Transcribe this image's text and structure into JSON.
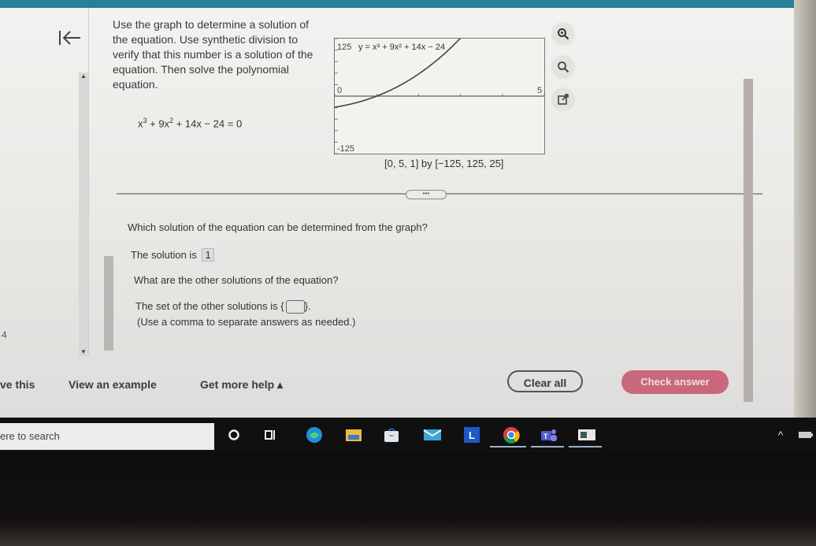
{
  "problem": {
    "instructions": "Use the graph to determine a solution of the equation. Use synthetic division to verify that this number is a solution of the equation. Then solve the polynomial equation.",
    "equation": {
      "term1_base": "x",
      "term1_exp": "3",
      "term2": " + 9x",
      "term2_exp": "2",
      "rest": " + 14x − 24 = 0"
    }
  },
  "side_panel": {
    "back_icon": "collapse-left-icon",
    "side_number": "4"
  },
  "graph_tools": [
    {
      "name": "zoom-in-icon"
    },
    {
      "name": "zoom-out-icon"
    },
    {
      "name": "popout-icon"
    }
  ],
  "chart_data": {
    "type": "line",
    "title": "y = x^3 + 9x^2 + 14x − 24",
    "function_label": "y = x³ + 9x² + 14x − 24",
    "xlim": [
      0,
      5
    ],
    "xscale": 1,
    "ylim": [
      -125,
      125
    ],
    "yscale": 25,
    "x_tick_labels": [
      "0",
      "5"
    ],
    "y_tick_labels": [
      "125",
      "-125"
    ],
    "window_caption": "[0, 5, 1] by [−125, 125, 25]",
    "series": [
      {
        "name": "y = x^3 + 9x^2 + 14x - 24",
        "x": [
          0,
          0.5,
          1,
          1.5,
          2,
          2.5
        ],
        "y": [
          -24,
          -14.625,
          0,
          20.625,
          48,
          82.875
        ]
      }
    ],
    "grid": false
  },
  "more_button": "•••",
  "questions": {
    "q1": "Which solution of the equation can be determined from the graph?",
    "q1_answer_prefix": "The solution is",
    "q1_answer": "1",
    "q2": "What are the other solutions of the equation?",
    "q2_answer_prefix": "The set of the other solutions is",
    "q2_set_open": "{",
    "q2_set_close": "}.",
    "q2_hint": "(Use a comma to separate answers as needed.)"
  },
  "footer": {
    "solve_this": "ve this",
    "view_example": "View an example",
    "get_more_help": "Get more help ▴",
    "clear_all": "Clear all",
    "check_answer": "Check answer",
    "accent_color": "#c9677d"
  },
  "taskbar": {
    "search_placeholder": "ere to search",
    "apps": [
      "cortana",
      "task-view",
      "edge",
      "file-explorer",
      "store",
      "mail",
      "l-app",
      "chrome",
      "teams",
      "app-window"
    ],
    "tray_chevron": "^"
  }
}
